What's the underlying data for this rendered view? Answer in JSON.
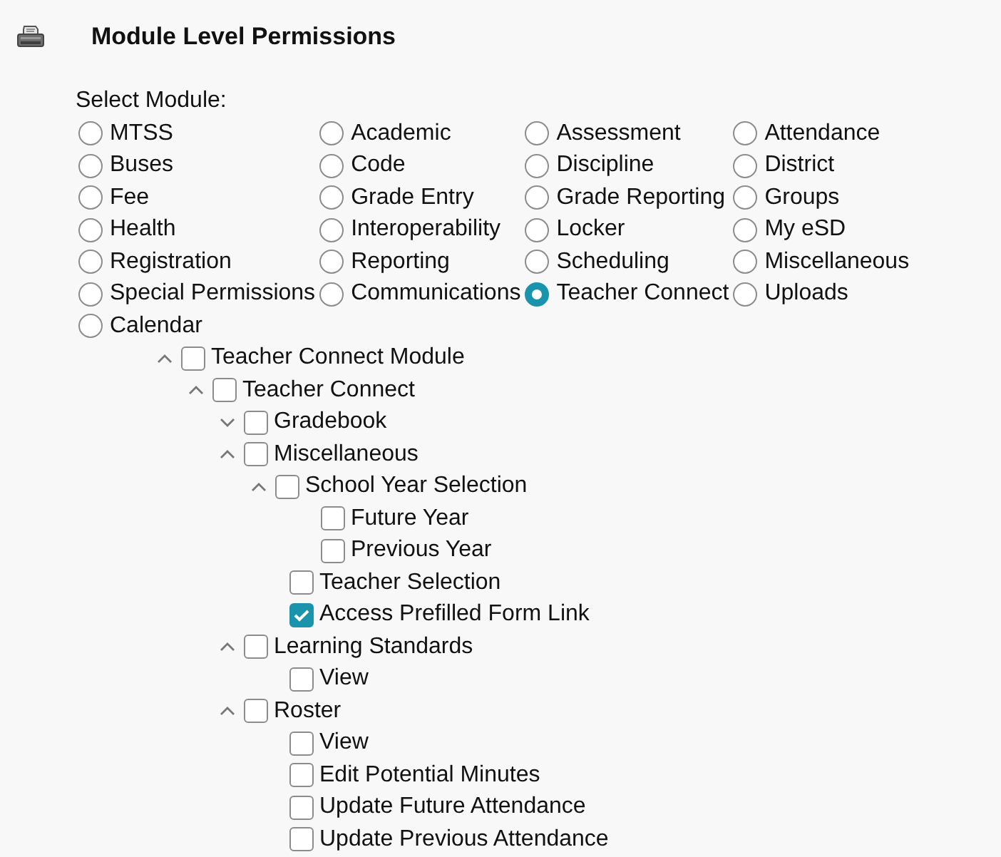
{
  "header": {
    "title": "Module Level Permissions"
  },
  "modules": {
    "label": "Select Module:",
    "options": [
      {
        "label": "MTSS",
        "selected": false
      },
      {
        "label": "Academic",
        "selected": false
      },
      {
        "label": "Assessment",
        "selected": false
      },
      {
        "label": "Attendance",
        "selected": false
      },
      {
        "label": "Buses",
        "selected": false
      },
      {
        "label": "Code",
        "selected": false
      },
      {
        "label": "Discipline",
        "selected": false
      },
      {
        "label": "District",
        "selected": false
      },
      {
        "label": "Fee",
        "selected": false
      },
      {
        "label": "Grade Entry",
        "selected": false
      },
      {
        "label": "Grade Reporting",
        "selected": false
      },
      {
        "label": "Groups",
        "selected": false
      },
      {
        "label": "Health",
        "selected": false
      },
      {
        "label": "Interoperability",
        "selected": false
      },
      {
        "label": "Locker",
        "selected": false
      },
      {
        "label": "My eSD",
        "selected": false
      },
      {
        "label": "Registration",
        "selected": false
      },
      {
        "label": "Reporting",
        "selected": false
      },
      {
        "label": "Scheduling",
        "selected": false
      },
      {
        "label": "Miscellaneous",
        "selected": false
      },
      {
        "label": "Special Permissions",
        "selected": false
      },
      {
        "label": "Communications",
        "selected": false
      },
      {
        "label": "Teacher Connect",
        "selected": true
      },
      {
        "label": "Uploads",
        "selected": false
      },
      {
        "label": "Calendar",
        "selected": false
      }
    ]
  },
  "tree": [
    {
      "label": "Teacher Connect Module",
      "kind": "group",
      "expanded": true,
      "checked": false,
      "children": [
        {
          "label": "Teacher Connect",
          "kind": "group",
          "expanded": true,
          "checked": false,
          "children": [
            {
              "label": "Gradebook",
              "kind": "group",
              "expanded": false,
              "checked": false
            },
            {
              "label": "Miscellaneous",
              "kind": "group",
              "expanded": true,
              "checked": false,
              "children": [
                {
                  "label": "School Year Selection",
                  "kind": "group",
                  "expanded": true,
                  "checked": false,
                  "children": [
                    {
                      "label": "Future Year",
                      "kind": "leaf",
                      "checked": false
                    },
                    {
                      "label": "Previous Year",
                      "kind": "leaf",
                      "checked": false
                    }
                  ]
                },
                {
                  "label": "Teacher Selection",
                  "kind": "leaf",
                  "checked": false
                },
                {
                  "label": "Access Prefilled Form Link",
                  "kind": "leaf",
                  "checked": true
                }
              ]
            },
            {
              "label": "Learning Standards",
              "kind": "group",
              "expanded": true,
              "checked": false,
              "children": [
                {
                  "label": "View",
                  "kind": "leaf",
                  "checked": false
                }
              ]
            },
            {
              "label": "Roster",
              "kind": "group",
              "expanded": true,
              "checked": false,
              "children": [
                {
                  "label": "View",
                  "kind": "leaf",
                  "checked": false
                },
                {
                  "label": "Edit Potential Minutes",
                  "kind": "leaf",
                  "checked": false
                },
                {
                  "label": "Update Future Attendance",
                  "kind": "leaf",
                  "checked": false
                },
                {
                  "label": "Update Previous Attendance",
                  "kind": "leaf",
                  "checked": false
                }
              ]
            }
          ]
        }
      ]
    }
  ]
}
